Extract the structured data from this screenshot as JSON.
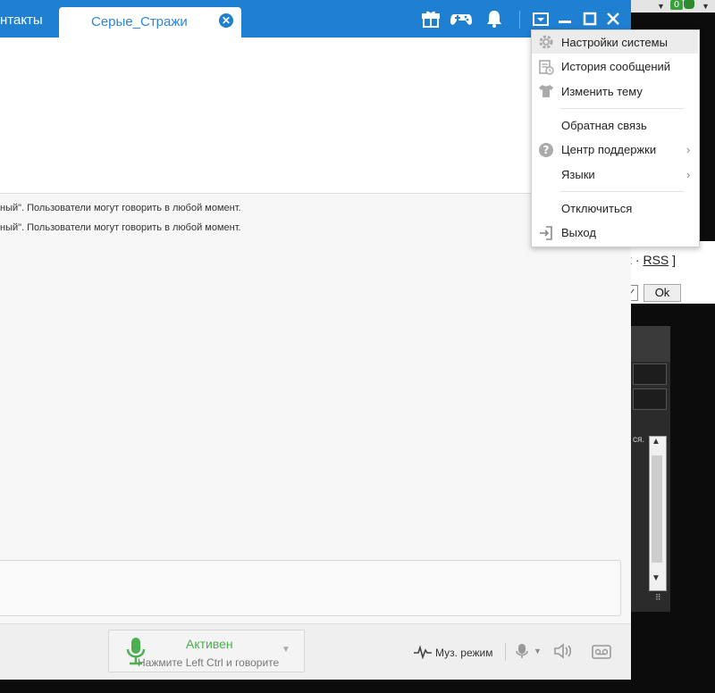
{
  "window": {
    "tab_contacts": "нтакты",
    "tab_active": "Серые_Стражи"
  },
  "chat": {
    "lines": [
      "ный\". Пользователи могут говорить в любой момент.",
      "ный\". Пользователи могут говорить в любой момент."
    ]
  },
  "bottom_bar": {
    "status_label": "Активен",
    "status_hint": "Нажмите Left Ctrl и говорите",
    "music_mode": "Муз. режим"
  },
  "menu": {
    "items": [
      {
        "label": "Настройки системы",
        "icon": "gear-icon"
      },
      {
        "label": "История сообщений",
        "icon": "history-icon"
      },
      {
        "label": "Изменить тему",
        "icon": "shirt-icon"
      },
      {
        "label": "Обратная связь"
      },
      {
        "label": "Центр поддержки",
        "icon": "help-icon",
        "submenu": true
      },
      {
        "label": "Языки",
        "submenu": true
      },
      {
        "label": "Отключиться"
      },
      {
        "label": "Выход",
        "icon": "exit-icon"
      }
    ]
  },
  "background": {
    "badge": "0",
    "rss_prefix": "k ·",
    "rss_link": "RSS",
    "rss_suffix": "]",
    "ok_button": "Ok",
    "snippet": "ся."
  },
  "colors": {
    "titlebar": "#1f7fd1",
    "tab_text": "#2f86d6",
    "active_green": "#4caf50"
  }
}
